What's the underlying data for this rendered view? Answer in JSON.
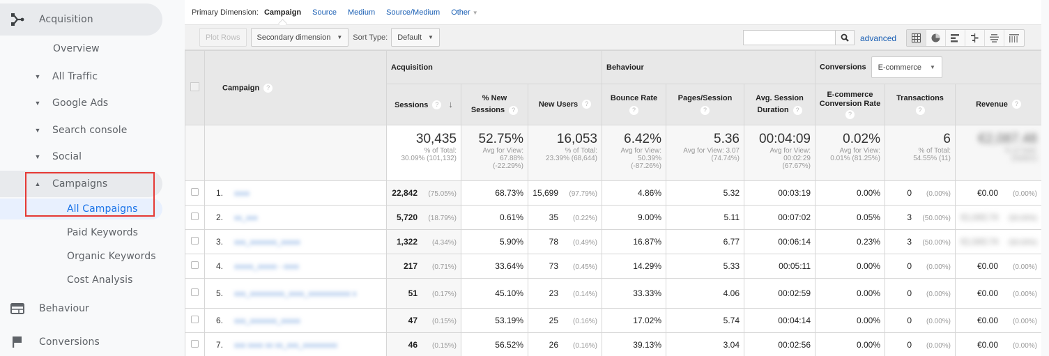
{
  "sidebar": {
    "top_items": [
      {
        "label": "Acquisition",
        "icon": "acquisition-icon",
        "active": true
      },
      {
        "label": "Behaviour",
        "icon": "behaviour-icon"
      },
      {
        "label": "Conversions",
        "icon": "flag-icon"
      }
    ],
    "overview": "Overview",
    "groups": [
      {
        "label": "All Traffic",
        "caret": "▼"
      },
      {
        "label": "Google Ads",
        "caret": "▼"
      },
      {
        "label": "Search console",
        "caret": "▼"
      },
      {
        "label": "Social",
        "caret": "▼"
      },
      {
        "label": "Campaigns",
        "caret": "▲"
      }
    ],
    "campaign_children": [
      "All Campaigns",
      "Paid Keywords",
      "Organic Keywords",
      "Cost Analysis"
    ],
    "selected": "All Campaigns",
    "highlight_color": "#e53935"
  },
  "dimension_bar": {
    "label": "Primary Dimension:",
    "active": "Campaign",
    "links": [
      "Source",
      "Medium",
      "Source/Medium"
    ],
    "other": "Other"
  },
  "toolbar": {
    "plot_rows": "Plot Rows",
    "secondary_dimension": "Secondary dimension",
    "sort_type_label": "Sort Type:",
    "sort_type_value": "Default",
    "search_placeholder": "",
    "advanced": "advanced",
    "views": [
      "table-view-icon",
      "pie-view-icon",
      "performance-view-icon",
      "comparison-view-icon",
      "term-cloud-icon",
      "pivot-view-icon"
    ]
  },
  "table": {
    "groups": {
      "acquisition": "Acquisition",
      "behaviour": "Behaviour",
      "conversions": "Conversions",
      "conversions_select": "E-commerce"
    },
    "headers": {
      "campaign": "Campaign",
      "sessions": "Sessions",
      "pct_new_1": "% New",
      "pct_new_2": "Sessions",
      "new_users": "New Users",
      "bounce": "Bounce Rate",
      "pages": "Pages/Session",
      "duration_1": "Avg. Session",
      "duration_2": "Duration",
      "ecom_1": "E-commerce",
      "ecom_2": "Conversion Rate",
      "transactions": "Transactions",
      "revenue": "Revenue"
    },
    "totals": {
      "sessions": {
        "value": "30,435",
        "sub1": "% of Total:",
        "sub2": "30.09% (101,132)"
      },
      "pct_new": {
        "value": "52.75%",
        "sub1": "Avg for View:",
        "sub2": "67.88%",
        "sub3": "(-22.29%)"
      },
      "new_users": {
        "value": "16,053",
        "sub1": "% of Total:",
        "sub2": "23.39% (68,644)"
      },
      "bounce": {
        "value": "6.42%",
        "sub1": "Avg for View:",
        "sub2": "50.39%",
        "sub3": "(-87.26%)"
      },
      "pages": {
        "value": "5.36",
        "sub1": "Avg for View: 3.07",
        "sub2": "(74.74%)"
      },
      "duration": {
        "value": "00:04:09",
        "sub1": "Avg for View:",
        "sub2": "00:02:29",
        "sub3": "(67.67%)"
      },
      "ecom": {
        "value": "0.02%",
        "sub1": "Avg for View:",
        "sub2": "0.01% (81.25%)"
      },
      "transactions": {
        "value": "6",
        "sub1": "% of Total:",
        "sub2": "54.55% (11)"
      },
      "revenue": {
        "value": "€2,087.48",
        "sub1": "% of Total:",
        "sub2": "(hidden)"
      }
    },
    "rows": [
      {
        "idx": "1.",
        "campaign": "hidden",
        "sessions": "22,842",
        "sessions_pct": "(75.05%)",
        "pct_new": "68.73%",
        "new_users": "15,699",
        "new_users_pct": "(97.79%)",
        "bounce": "4.86%",
        "pages": "5.32",
        "duration": "00:03:19",
        "ecom": "0.00%",
        "transactions": "0",
        "transactions_pct": "(0.00%)",
        "revenue": "€0.00",
        "revenue_pct": "(0.00%)"
      },
      {
        "idx": "2.",
        "campaign": "hidden",
        "sessions": "5,720",
        "sessions_pct": "(18.79%)",
        "pct_new": "0.61%",
        "new_users": "35",
        "new_users_pct": "(0.22%)",
        "bounce": "9.00%",
        "pages": "5.11",
        "duration": "00:07:02",
        "ecom": "0.05%",
        "transactions": "3",
        "transactions_pct": "(50.00%)",
        "revenue": "hidden",
        "revenue_pct": "hidden"
      },
      {
        "idx": "3.",
        "campaign": "hidden",
        "sessions": "1,322",
        "sessions_pct": "(4.34%)",
        "pct_new": "5.90%",
        "new_users": "78",
        "new_users_pct": "(0.49%)",
        "bounce": "16.87%",
        "pages": "6.77",
        "duration": "00:06:14",
        "ecom": "0.23%",
        "transactions": "3",
        "transactions_pct": "(50.00%)",
        "revenue": "hidden",
        "revenue_pct": "hidden"
      },
      {
        "idx": "4.",
        "campaign": "hidden",
        "sessions": "217",
        "sessions_pct": "(0.71%)",
        "pct_new": "33.64%",
        "new_users": "73",
        "new_users_pct": "(0.45%)",
        "bounce": "14.29%",
        "pages": "5.33",
        "duration": "00:05:11",
        "ecom": "0.00%",
        "transactions": "0",
        "transactions_pct": "(0.00%)",
        "revenue": "€0.00",
        "revenue_pct": "(0.00%)"
      },
      {
        "idx": "5.",
        "campaign": "hidden",
        "sessions": "51",
        "sessions_pct": "(0.17%)",
        "pct_new": "45.10%",
        "new_users": "23",
        "new_users_pct": "(0.14%)",
        "bounce": "33.33%",
        "pages": "4.06",
        "duration": "00:02:59",
        "ecom": "0.00%",
        "transactions": "0",
        "transactions_pct": "(0.00%)",
        "revenue": "€0.00",
        "revenue_pct": "(0.00%)"
      },
      {
        "idx": "6.",
        "campaign": "hidden",
        "sessions": "47",
        "sessions_pct": "(0.15%)",
        "pct_new": "53.19%",
        "new_users": "25",
        "new_users_pct": "(0.16%)",
        "bounce": "17.02%",
        "pages": "5.74",
        "duration": "00:04:14",
        "ecom": "0.00%",
        "transactions": "0",
        "transactions_pct": "(0.00%)",
        "revenue": "€0.00",
        "revenue_pct": "(0.00%)"
      },
      {
        "idx": "7.",
        "campaign": "hidden",
        "sessions": "46",
        "sessions_pct": "(0.15%)",
        "pct_new": "56.52%",
        "new_users": "26",
        "new_users_pct": "(0.16%)",
        "bounce": "39.13%",
        "pages": "3.04",
        "duration": "00:02:56",
        "ecom": "0.00%",
        "transactions": "0",
        "transactions_pct": "(0.00%)",
        "revenue": "€0.00",
        "revenue_pct": "(0.00%)"
      }
    ]
  }
}
